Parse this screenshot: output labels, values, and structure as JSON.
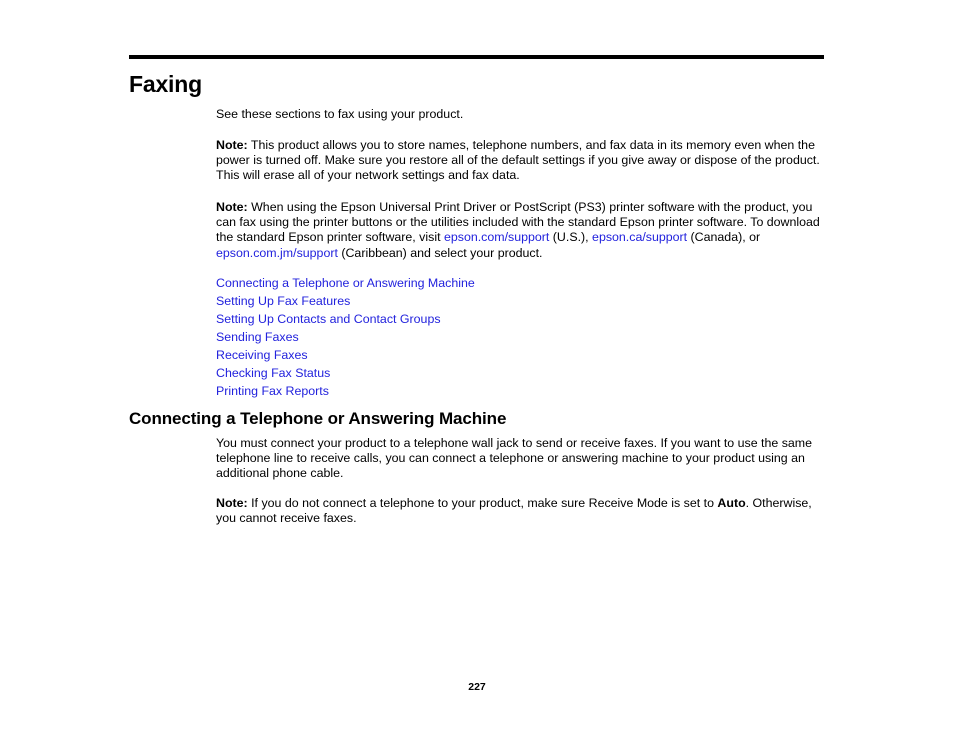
{
  "page": {
    "title": "Faxing",
    "intro": "See these sections to fax using your product.",
    "page_number": "227",
    "link_color": "#2222dd",
    "text_color": "#000000",
    "background": "#ffffff"
  },
  "notes": {
    "label": "Note:",
    "note1_text": " This product allows you to store names, telephone numbers, and fax data in its memory even when the power is turned off. Make sure you restore all of the default settings if you give away or dispose of the product. This will erase all of your network settings and fax data.",
    "note2": {
      "part1": " When using the Epson Universal Print Driver or PostScript (PS3) printer software with the product, you can fax using the printer buttons or the utilities included with the standard Epson printer software. To download the standard Epson printer software, visit ",
      "link1": "epson.com/support",
      "part2": " (U.S.), ",
      "link2": "epson.ca/support",
      "part3": " (Canada), or ",
      "link3": "epson.com.jm/support",
      "part4": " (Caribbean) and select your product."
    },
    "note3": {
      "part1": " If you do not connect a telephone to your product, make sure Receive Mode is set to ",
      "bold1": "Auto",
      "part2": ". Otherwise, you cannot receive faxes."
    }
  },
  "toc_links": [
    {
      "label": "Connecting a Telephone or Answering Machine"
    },
    {
      "label": "Setting Up Fax Features"
    },
    {
      "label": "Setting Up Contacts and Contact Groups"
    },
    {
      "label": "Sending Faxes"
    },
    {
      "label": "Receiving Faxes"
    },
    {
      "label": "Checking Fax Status"
    },
    {
      "label": "Printing Fax Reports"
    }
  ],
  "section": {
    "heading": "Connecting a Telephone or Answering Machine",
    "body": "You must connect your product to a telephone wall jack to send or receive faxes. If you want to use the same telephone line to receive calls, you can connect a telephone or answering machine to your product using an additional phone cable."
  }
}
